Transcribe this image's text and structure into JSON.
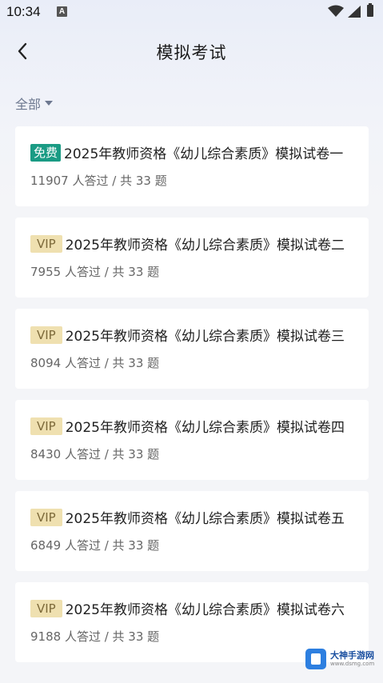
{
  "status_bar": {
    "time": "10:34",
    "notification_icon": "A"
  },
  "header": {
    "title": "模拟考试",
    "back_icon": "chevron-left-icon"
  },
  "filter": {
    "label": "全部"
  },
  "exams": [
    {
      "badge": "免费",
      "badge_type": "free",
      "title": "2025年教师资格《幼儿综合素质》模拟试卷一",
      "meta": "11907 人答过 / 共 33 题"
    },
    {
      "badge": "VIP",
      "badge_type": "vip",
      "title": "2025年教师资格《幼儿综合素质》模拟试卷二",
      "meta": "7955 人答过 / 共 33 题"
    },
    {
      "badge": "VIP",
      "badge_type": "vip",
      "title": "2025年教师资格《幼儿综合素质》模拟试卷三",
      "meta": "8094 人答过 / 共 33 题"
    },
    {
      "badge": "VIP",
      "badge_type": "vip",
      "title": "2025年教师资格《幼儿综合素质》模拟试卷四",
      "meta": "8430 人答过 / 共 33 题"
    },
    {
      "badge": "VIP",
      "badge_type": "vip",
      "title": "2025年教师资格《幼儿综合素质》模拟试卷五",
      "meta": "6849 人答过 / 共 33 题"
    },
    {
      "badge": "VIP",
      "badge_type": "vip",
      "title": "2025年教师资格《幼儿综合素质》模拟试卷六",
      "meta": "9188 人答过 / 共 33 题"
    }
  ],
  "watermark": {
    "name": "大神手游网",
    "url": "www.dsmg.com"
  },
  "colors": {
    "free_badge": "#1a9b84",
    "vip_badge_bg": "#efe0b0",
    "vip_badge_text": "#7d6a3a",
    "filter_text": "#6d7890"
  }
}
